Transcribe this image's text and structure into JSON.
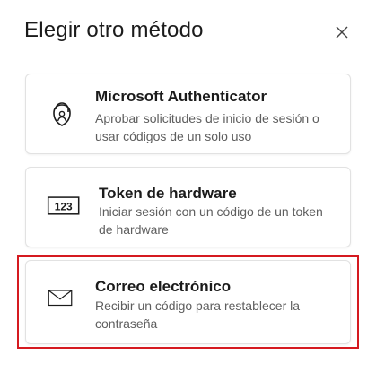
{
  "dialog": {
    "title": "Elegir otro método",
    "close_icon": "close-icon"
  },
  "methods": [
    {
      "icon": "authenticator-lock-icon",
      "title": "Microsoft Authenticator",
      "description": "Aprobar solicitudes de inicio de sesión o usar códigos de un solo uso"
    },
    {
      "icon": "hardware-token-123-icon",
      "icon_text": "123",
      "title": "Token de hardware",
      "description": "Iniciar sesión con un código de un token de hardware"
    },
    {
      "icon": "envelope-icon",
      "title": "Correo electrónico",
      "description": "Recibir un código para restablecer la contraseña",
      "highlighted": true
    }
  ],
  "colors": {
    "highlight_border": "#d51a20",
    "card_border": "#e2e2e2",
    "title_text": "#1b1b1b",
    "description_text": "#5e5e5e"
  }
}
